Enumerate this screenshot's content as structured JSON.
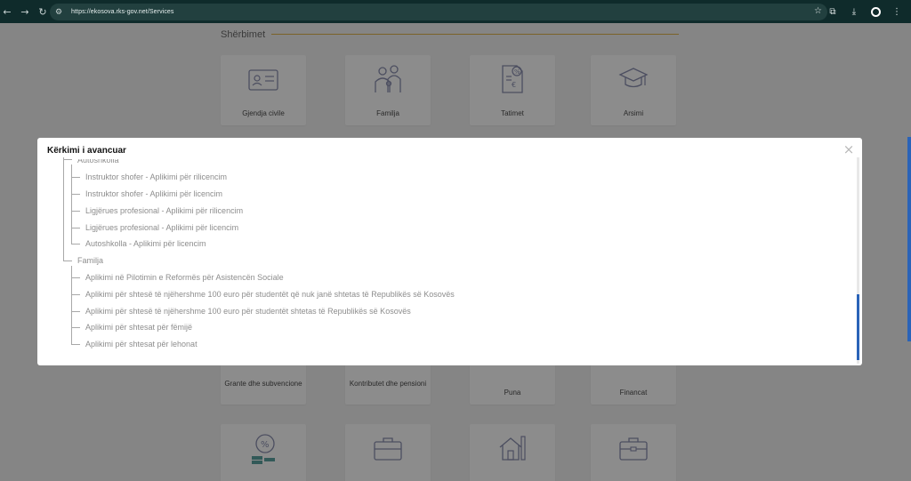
{
  "browser": {
    "url": "https://ekosova.rks-gov.net/Services",
    "icons": {
      "back": "back-arrow-icon",
      "forward": "forward-arrow-icon",
      "reload": "reload-icon",
      "site_info": "tune-icon",
      "bookmark": "star-icon",
      "extensions": "puzzle-icon",
      "downloads": "download-icon",
      "profile": "profile-icon",
      "menu": "kebab-menu-icon"
    }
  },
  "page": {
    "section_title": "Shërbimet",
    "accent_color": "#e0b44a",
    "cards_row1": [
      {
        "label": "Gjendja civile",
        "icon": "id-card-icon"
      },
      {
        "label": "Familja",
        "icon": "family-icon"
      },
      {
        "label": "Tatimet",
        "icon": "tax-document-icon"
      },
      {
        "label": "Arsimi",
        "icon": "graduation-cap-icon"
      }
    ],
    "cards_row2": [
      {
        "label": "Grante dhe subvencione"
      },
      {
        "label": "Kontributet dhe pensioni"
      },
      {
        "label": "Puna"
      },
      {
        "label": "Financat"
      }
    ],
    "cards_row3": [
      {
        "icon": "coins-percent-icon"
      },
      {
        "icon": "briefcase-icon"
      },
      {
        "icon": "house-icon"
      },
      {
        "icon": "briefcase-alt-icon"
      }
    ]
  },
  "modal": {
    "title": "Kërkimi i avancuar",
    "close_icon": "close-icon",
    "tree": {
      "partial_parent": "Autoshkolla",
      "group1_items": [
        "Instruktor shofer - Aplikimi për rilicencim",
        "Instruktor shofer - Aplikimi për licencim",
        "Ligjërues profesional - Aplikimi për rilicencim",
        "Ligjërues profesional - Aplikimi për licencim",
        "Autoshkolla - Aplikimi për licencim"
      ],
      "group2_title": "Familja",
      "group2_items": [
        "Aplikimi në Pilotimin e Reformës për Asistencën Sociale",
        "Aplikimi për shtesë të njëhershme 100 euro për studentët që nuk janë shtetas të Republikës së Kosovës",
        "Aplikimi për shtesë të njëhershme 100 euro për studentët shtetas të Republikës së Kosovës",
        "Aplikimi për shtesat për fëmijë",
        "Aplikimi për shtesat për lehonat"
      ]
    },
    "scrollbar_color": "#2a63b8"
  }
}
